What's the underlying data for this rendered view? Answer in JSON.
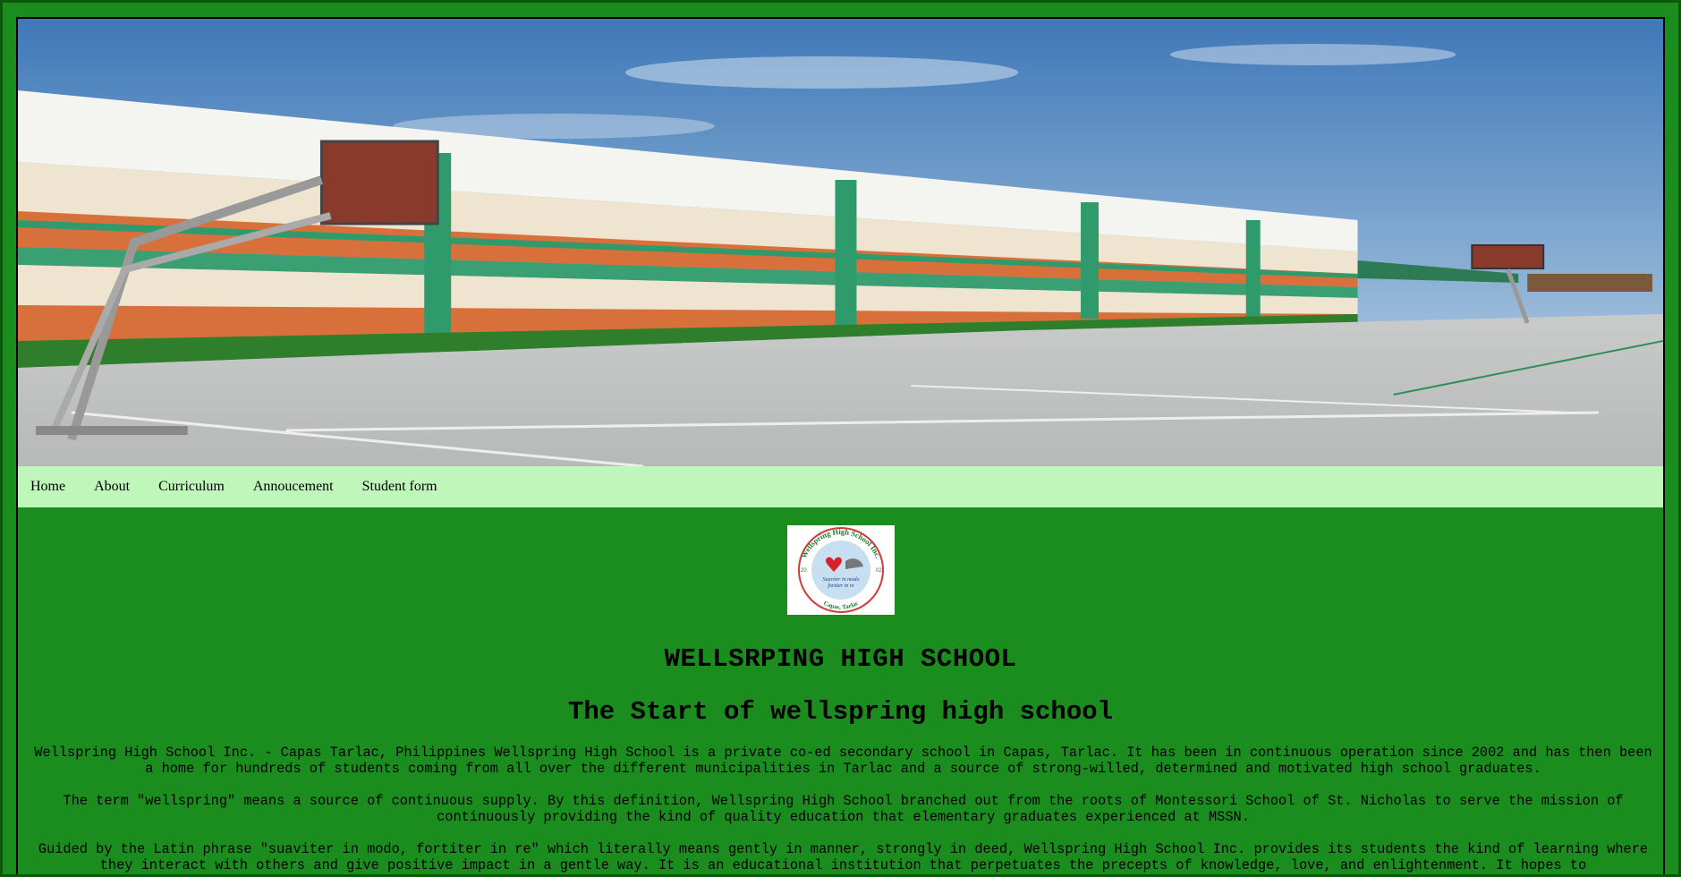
{
  "nav": {
    "items": [
      {
        "label": "Home"
      },
      {
        "label": "About"
      },
      {
        "label": "Curriculum"
      },
      {
        "label": "Annoucement"
      },
      {
        "label": "Student form"
      }
    ]
  },
  "logo": {
    "top_text": "Wellspring High School Inc.",
    "motto_1": "Suaviter in modo",
    "motto_2": "fortiter in re",
    "bottom_text": "Capas, Tarlac",
    "year_left": "20",
    "year_right": "02"
  },
  "main": {
    "title": "WELLSRPING HIGH SCHOOL",
    "subtitle": "The Start of wellspring high school",
    "paragraphs": [
      "Wellspring High School Inc. - Capas Tarlac, Philippines Wellspring High School is a private co-ed secondary school in Capas, Tarlac. It has been in continuous operation since 2002 and has then been a home for hundreds of students coming from all over the different municipalities in Tarlac and a source of strong-willed, determined and motivated high school graduates.",
      "The term \"wellspring\" means a source of continuous supply. By this definition, Wellspring High School branched out from the roots of Montessori School of St. Nicholas to serve the mission of continuously providing the kind of quality education that elementary graduates experienced at MSSN.",
      "Guided by the Latin phrase \"suaviter in modo, fortiter in re\" which literally means gently in manner, strongly in deed, Wellspring High School Inc. provides its students the kind of learning where they interact with others and give positive impact in a gentle way. It is an educational institution that perpetuates the precepts of knowledge, love, and enlightenment. It hopes to"
    ]
  },
  "colors": {
    "page_bg": "#1b8c1e",
    "nav_bg": "#bff7bb",
    "border": "#0a5a0a"
  }
}
